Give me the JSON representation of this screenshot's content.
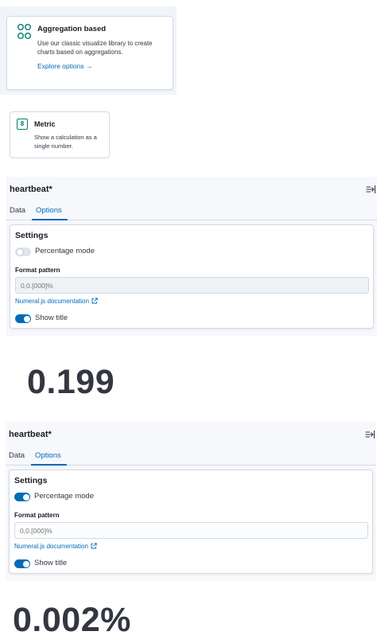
{
  "aggregation_card": {
    "title": "Aggregation based",
    "description": "Use our classic visualize library to create charts based on aggregations.",
    "link": "Explore options →",
    "icon": "aggregation-icon"
  },
  "metric_card": {
    "title": "Metric",
    "description": "Show a calculation as a single number.",
    "icon_glyph": "8"
  },
  "editor_top": {
    "title": "heartbeat*",
    "tabs": [
      "Data",
      "Options"
    ],
    "active_tab": "Options",
    "settings_title": "Settings",
    "percentage_mode_label": "Percentage mode",
    "percentage_mode_on": false,
    "format_pattern_label": "Format pattern",
    "format_pattern_placeholder": "0,0.[000]%",
    "doc_link": "Numeral.js documentation",
    "show_title_label": "Show title",
    "show_title_on": true
  },
  "value_top": "0.199",
  "editor_bottom": {
    "title": "heartbeat*",
    "tabs": [
      "Data",
      "Options"
    ],
    "active_tab": "Options",
    "settings_title": "Settings",
    "percentage_mode_label": "Percentage mode",
    "percentage_mode_on": true,
    "format_pattern_label": "Format pattern",
    "format_pattern_placeholder": "0,0.[000]%",
    "doc_link": "Numeral.js documentation",
    "show_title_label": "Show title",
    "show_title_on": true
  },
  "value_bottom": "0.002%",
  "colors": {
    "accent": "#006bb8",
    "teal_icon": "#017d73",
    "text": "#1a1c21",
    "value_text": "#343741"
  }
}
